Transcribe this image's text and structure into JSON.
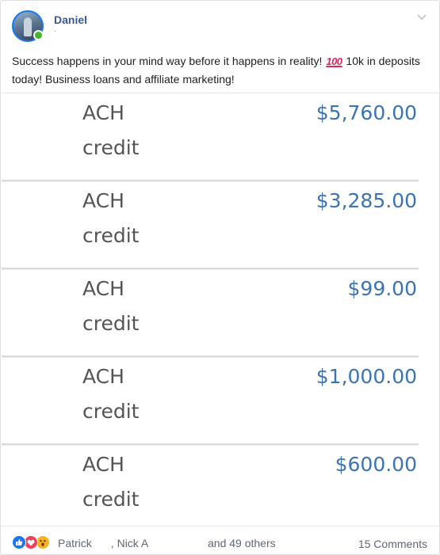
{
  "post": {
    "author": "Daniel",
    "meta": "·",
    "text_before_emoji": "Success happens in your mind way before it happens in reality! ",
    "emoji": "100",
    "text_after_emoji": " 10k in deposits today! Business loans and affiliate marketing!"
  },
  "transactions": [
    {
      "type": "ACH",
      "subtype": "credit",
      "amount": "$5,760.00"
    },
    {
      "type": "ACH",
      "subtype": "credit",
      "amount": "$3,285.00"
    },
    {
      "type": "ACH",
      "subtype": "credit",
      "amount": "$99.00"
    },
    {
      "type": "ACH",
      "subtype": "credit",
      "amount": "$1,000.00"
    },
    {
      "type": "ACH",
      "subtype": "credit",
      "amount": "$600.00"
    }
  ],
  "footer": {
    "reactions": [
      "like-icon",
      "love-icon",
      "wow-icon"
    ],
    "name_1": "Patrick",
    "separator": ", ",
    "name_2": "Nick A",
    "others": "and 49 others",
    "comments": "15 Comments"
  },
  "colors": {
    "author_name": "#385898",
    "online": "#42b72a",
    "amount": "#3b74b3",
    "ach_text": "#555555"
  }
}
